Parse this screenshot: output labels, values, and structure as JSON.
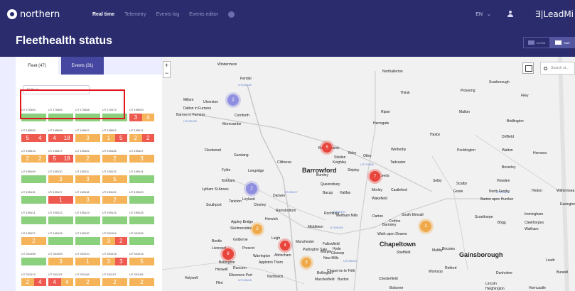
{
  "app": {
    "brand": "northern",
    "title": "Fleethealth status",
    "operator": "LeadMi"
  },
  "nav": {
    "items": [
      "Real time",
      "Telemetry",
      "Events log",
      "Events editor"
    ],
    "active": "Real time"
  },
  "locale": {
    "lang": "EN"
  },
  "view_toggle": {
    "icons": "ICONS",
    "map": "MAP",
    "active": "MAP"
  },
  "tabs": [
    {
      "label": "Fleet (47)",
      "active": true
    },
    {
      "label": "Events (31)",
      "active": false
    }
  ],
  "filter": {
    "placeholder": "All fleet"
  },
  "colors": {
    "navy": "#2b2c6e",
    "green": "#8bd07c",
    "orange": "#f5b45a",
    "red": "#ee5a4f",
    "highlight": "#e2141d"
  },
  "fleet_rows": [
    [
      {
        "id": "UT 170453",
        "cells": [
          {
            "c": "g",
            "t": ""
          }
        ]
      },
      {
        "id": "UT 170454",
        "cells": [
          {
            "c": "g",
            "t": ""
          }
        ]
      },
      {
        "id": "UT 170458",
        "cells": [
          {
            "c": "g",
            "t": ""
          }
        ]
      },
      {
        "id": "UT 170473",
        "cells": [
          {
            "c": "g",
            "t": ""
          }
        ]
      },
      {
        "id": "UT 195003",
        "cells": [
          {
            "c": "r",
            "t": "3"
          },
          {
            "c": "o",
            "t": "4"
          }
        ]
      }
    ],
    [
      {
        "id": "UT 195005",
        "cells": [
          {
            "c": "r",
            "t": "5"
          },
          {
            "c": "r",
            "t": "4"
          }
        ]
      },
      {
        "id": "UT 195006",
        "cells": [
          {
            "c": "r",
            "t": "4"
          },
          {
            "c": "r",
            "t": "18"
          }
        ]
      },
      {
        "id": "UT 195007",
        "cells": [
          {
            "c": "o",
            "t": "3"
          }
        ]
      },
      {
        "id": "UT 195002",
        "cells": [
          {
            "c": "o",
            "t": "1"
          },
          {
            "c": "r",
            "t": "5"
          }
        ]
      },
      {
        "id": "UT 195011",
        "cells": [
          {
            "c": "o",
            "t": "2"
          },
          {
            "c": "r",
            "t": "2"
          }
        ]
      }
    ],
    [
      {
        "id": "UT 195013",
        "cells": [
          {
            "c": "o",
            "t": "2"
          },
          {
            "c": "o",
            "t": "2"
          }
        ]
      },
      {
        "id": "UT 195017",
        "cells": [
          {
            "c": "r",
            "t": "5"
          },
          {
            "c": "r",
            "t": "18"
          }
        ]
      },
      {
        "id": "UT 195102",
        "cells": [
          {
            "c": "o",
            "t": "2"
          }
        ]
      },
      {
        "id": "UT 195106",
        "cells": [
          {
            "c": "o",
            "t": "2"
          }
        ]
      },
      {
        "id": "UT 195107",
        "cells": [
          {
            "c": "o",
            "t": "3"
          }
        ]
      }
    ],
    [
      {
        "id": "UT 195109",
        "cells": [
          {
            "c": "g",
            "t": ""
          }
        ]
      },
      {
        "id": "UT 195110",
        "cells": [
          {
            "c": "o",
            "t": "3"
          }
        ]
      },
      {
        "id": "UT 195111",
        "cells": [
          {
            "c": "o",
            "t": "3"
          }
        ]
      },
      {
        "id": "UT 195113",
        "cells": [
          {
            "c": "o",
            "t": "5"
          }
        ]
      },
      {
        "id": "UT 195114",
        "cells": [
          {
            "c": "g",
            "t": ""
          }
        ]
      }
    ],
    [
      {
        "id": "UT 195115",
        "cells": [
          {
            "c": "g",
            "t": ""
          }
        ]
      },
      {
        "id": "UT 195117",
        "cells": [
          {
            "c": "r",
            "t": "1"
          }
        ]
      },
      {
        "id": "UT 195118",
        "cells": [
          {
            "c": "o",
            "t": "3"
          }
        ]
      },
      {
        "id": "UT 195119",
        "cells": [
          {
            "c": "o",
            "t": "2"
          }
        ]
      },
      {
        "id": "UT 195120",
        "cells": [
          {
            "c": "g",
            "t": ""
          }
        ]
      }
    ],
    [
      {
        "id": "UT 195121",
        "cells": [
          {
            "c": "g",
            "t": ""
          }
        ]
      },
      {
        "id": "UT 195122",
        "cells": [
          {
            "c": "g",
            "t": ""
          }
        ]
      },
      {
        "id": "UT 195123",
        "cells": [
          {
            "c": "g",
            "t": ""
          }
        ]
      },
      {
        "id": "UT 195124",
        "cells": [
          {
            "c": "g",
            "t": ""
          }
        ]
      },
      {
        "id": "UT 195125",
        "cells": [
          {
            "c": "g",
            "t": ""
          }
        ]
      }
    ],
    [
      {
        "id": "UT 195127",
        "cells": [
          {
            "c": "o",
            "t": "2"
          }
        ]
      },
      {
        "id": "UT 195128",
        "cells": [
          {
            "c": "g",
            "t": ""
          }
        ]
      },
      {
        "id": "UT 195130",
        "cells": [
          {
            "c": "g",
            "t": ""
          }
        ]
      },
      {
        "id": "UT 331004",
        "cells": [
          {
            "c": "o",
            "t": "3"
          },
          {
            "c": "r",
            "t": "2"
          }
        ]
      },
      {
        "id": "UT 331005",
        "cells": [
          {
            "c": "g",
            "t": ""
          }
        ]
      }
    ],
    [
      {
        "id": "UT 331008",
        "cells": [
          {
            "c": "g",
            "t": ""
          }
        ]
      },
      {
        "id": "UT 331009",
        "cells": [
          {
            "c": "o",
            "t": "3"
          }
        ]
      },
      {
        "id": "UT 331010",
        "cells": [
          {
            "c": "o",
            "t": "1"
          }
        ]
      },
      {
        "id": "UT 331015",
        "cells": [
          {
            "c": "o",
            "t": "3"
          },
          {
            "c": "r",
            "t": "3"
          }
        ]
      },
      {
        "id": "UT 331016",
        "cells": [
          {
            "c": "o",
            "t": "5"
          }
        ]
      }
    ],
    [
      {
        "id": "UT 331019",
        "cells": [
          {
            "c": "o",
            "t": "2"
          },
          {
            "c": "r",
            "t": "4"
          }
        ]
      },
      {
        "id": "UT 331103",
        "cells": [
          {
            "c": "r",
            "t": "4"
          },
          {
            "c": "o",
            "t": "4"
          }
        ]
      },
      {
        "id": "UT 331106",
        "cells": [
          {
            "c": "o",
            "t": "2"
          }
        ]
      },
      {
        "id": "UT 331107",
        "cells": [
          {
            "c": "o",
            "t": "2"
          }
        ]
      },
      {
        "id": "UT 331108",
        "cells": [
          {
            "c": "o",
            "t": "2"
          }
        ]
      }
    ]
  ],
  "map": {
    "search_placeholder": "Search st...",
    "places": [
      "Windermere",
      "Kendal",
      "Northallerton",
      "Scarborough",
      "Pickering",
      "Filey",
      "Millom",
      "Ulverston",
      "Thirsk",
      "Dalton in Furness",
      "Barrow in Furness",
      "Ripon",
      "Malton",
      "Bridlington",
      "Cornforth",
      "Morecambe",
      "Harrogate",
      "Haxby",
      "Driffield",
      "Fleetwood",
      "Garstang",
      "Barnoldswick",
      "Silsden",
      "Ilkley",
      "Otley",
      "Wetherby",
      "Pocklington",
      "Watton",
      "Hornsea",
      "Clitheroe",
      "Keighley",
      "Tadcaster",
      "Beverley",
      "Fylde",
      "Longridge",
      "Barrowford",
      "Burnley",
      "Shipley",
      "Leeds",
      "Selby",
      "Kirkham",
      "Queensbury",
      "Howden",
      "Scalby",
      "Hedon",
      "Withernsea",
      "Lytham St Annes",
      "Bacup",
      "Halifax",
      "Morley",
      "Castleford",
      "Goole",
      "North Ferriby",
      "Southport",
      "Tarleton",
      "Leyland",
      "Darwen",
      "Chorley",
      "Ramsbottom",
      "Wakefield",
      "Barton upon Humber",
      "Easington",
      "Horwich",
      "Rochdale",
      "Meltham Mills",
      "Darton",
      "South Elmsall",
      "Crofton",
      "Scunthorpe",
      "Immingham",
      "Appley Bridge",
      "Skelmersdale",
      "Middleton",
      "Barnsley",
      "Brigg",
      "Cleethorpes",
      "Waltham",
      "Bootle",
      "Golborne",
      "Leigh",
      "Manchester",
      "Wath upon Dearne",
      "Chapeltown",
      "Fallowfield",
      "Hyde",
      "Partington Sale",
      "Marple",
      "Glossop",
      "Sheffield",
      "Maltby",
      "Bircotes",
      "Gainsborough",
      "Louth",
      "Liverpool",
      "Prescot",
      "Warrington",
      "Altrincham",
      "Bebington",
      "Runcorn",
      "Appleton Thorn",
      "New Mills",
      "Heswall",
      "Ellesmere Port",
      "Northwich",
      "Bollington",
      "Chapel en le Frith",
      "Worksop",
      "Retford",
      "Dunholme",
      "Burwell",
      "Holywell",
      "Flint",
      "Macclesfield",
      "Buxton",
      "Chesterfield",
      "Bolsover",
      "Lincoln",
      "Heighington",
      "Horncastle"
    ],
    "unit_labels": [
      "UT195126",
      "UT195125",
      "UT170458",
      "UT195127",
      "UT195120",
      "UT170473",
      "UT195105",
      "UT195108",
      "UT195109"
    ],
    "clusters": [
      {
        "count": "2"
      },
      {
        "count": "2"
      },
      {
        "count": "5"
      },
      {
        "count": "7"
      },
      {
        "count": "2"
      },
      {
        "count": "8"
      },
      {
        "count": "4"
      },
      {
        "count": "3"
      },
      {
        "count": "2"
      },
      {
        "count": "2"
      }
    ]
  }
}
